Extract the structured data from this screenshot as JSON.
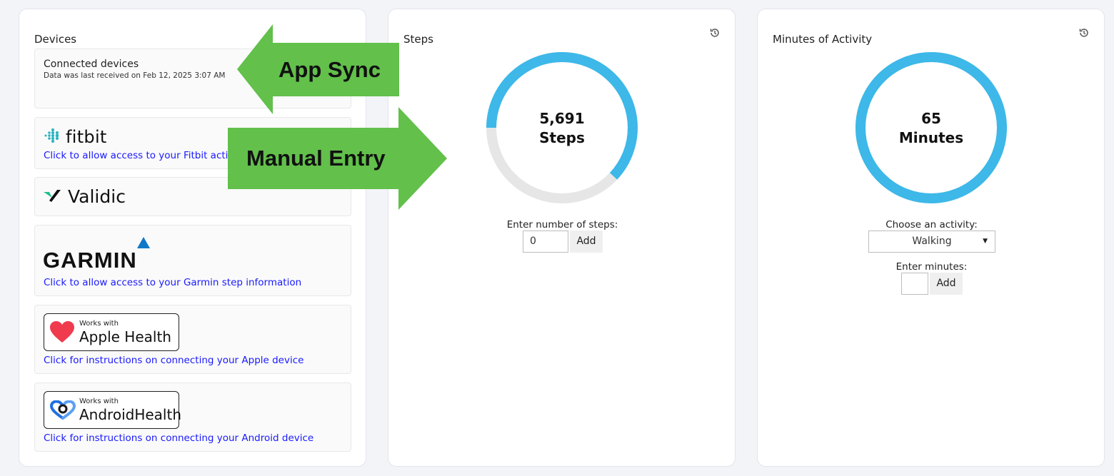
{
  "devices": {
    "title": "Devices",
    "connected_title": "Connected devices",
    "connected_sub": "Data was last received on Feb 12, 2025 3:07 AM",
    "fitbit": {
      "logo": "fitbit",
      "link": "Click to allow access to your Fitbit activ"
    },
    "validic": {
      "logo": "Validic"
    },
    "garmin": {
      "logo": "GARMIN",
      "link": "Click to allow access to your Garmin step information"
    },
    "apple": {
      "badge_small": "Works with",
      "badge_big": "Apple Health",
      "link": "Click for instructions on connecting your Apple device"
    },
    "android": {
      "badge_small": "Works with",
      "badge_big": "AndroidHealth",
      "link": "Click for instructions on connecting your Android device"
    }
  },
  "steps": {
    "title": "Steps",
    "value": "5,691",
    "unit": "Steps",
    "progress": 0.62,
    "enter_label": "Enter number of steps:",
    "input_value": "0",
    "add_label": "Add"
  },
  "activity": {
    "title": "Minutes of Activity",
    "value": "65",
    "unit": "Minutes",
    "progress": 1.0,
    "choose_label": "Choose an activity:",
    "selected_activity": "Walking",
    "enter_label": "Enter minutes:",
    "add_label": "Add"
  },
  "annotations": {
    "app_sync": "App Sync",
    "manual_entry": "Manual Entry"
  },
  "colors": {
    "ring": "#3db8e8",
    "ring_track": "#e6e6e6",
    "arrow": "#62c04b",
    "link": "#1a1aff"
  },
  "icons": [
    "history-icon",
    "fitbit-dots-icon",
    "validic-check-icon",
    "garmin-triangle-icon",
    "heart-icon",
    "android-health-icon",
    "dropdown-caret-icon"
  ]
}
